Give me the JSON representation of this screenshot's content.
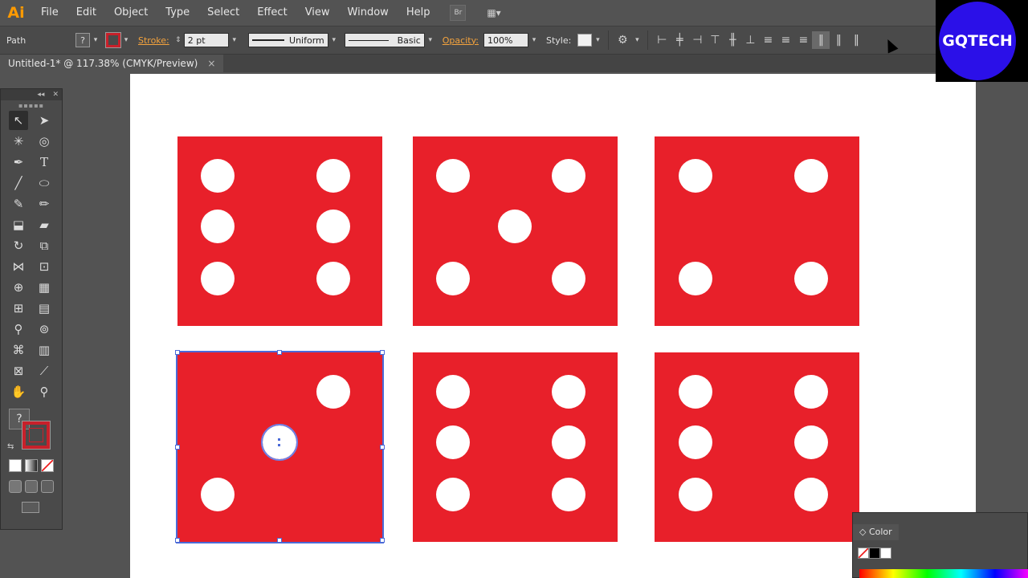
{
  "app": {
    "logo": "Ai",
    "menu": [
      "File",
      "Edit",
      "Object",
      "Type",
      "Select",
      "Effect",
      "View",
      "Window",
      "Help"
    ],
    "bridge_button": "Br",
    "layout_button": "▦▾"
  },
  "control_bar": {
    "selection_type": "Path",
    "fill_icon": "?",
    "stroke_label": "Stroke:",
    "stroke_value": "2 pt",
    "profile_label": "Uniform",
    "brush_label": "Basic",
    "opacity_label": "Opacity:",
    "opacity_value": "100%",
    "style_label": "Style:",
    "align_icons": [
      "align-left-icon",
      "align-hcenter-icon",
      "align-right-icon",
      "align-top-icon",
      "align-vcenter-icon",
      "align-bottom-icon",
      "distribute-top-icon",
      "distribute-vcenter-icon",
      "distribute-bottom-icon",
      "distribute-left-icon",
      "distribute-hcenter-icon",
      "distribute-right-icon"
    ]
  },
  "document": {
    "tab_title": "Untitled-1* @ 117.38% (CMYK/Preview)",
    "close_glyph": "×"
  },
  "tools_panel": {
    "unknown_fill_glyph": "?",
    "swap_glyph": "⇆"
  },
  "color_panel": {
    "tab_title": "◇ Color"
  },
  "watermark": {
    "text": "GQTECH"
  },
  "colors": {
    "die_red": "#e8202a",
    "selection_blue": "#4b6ad8",
    "watermark_blue": "#2b10e8",
    "logo_orange": "#ff9a00"
  }
}
